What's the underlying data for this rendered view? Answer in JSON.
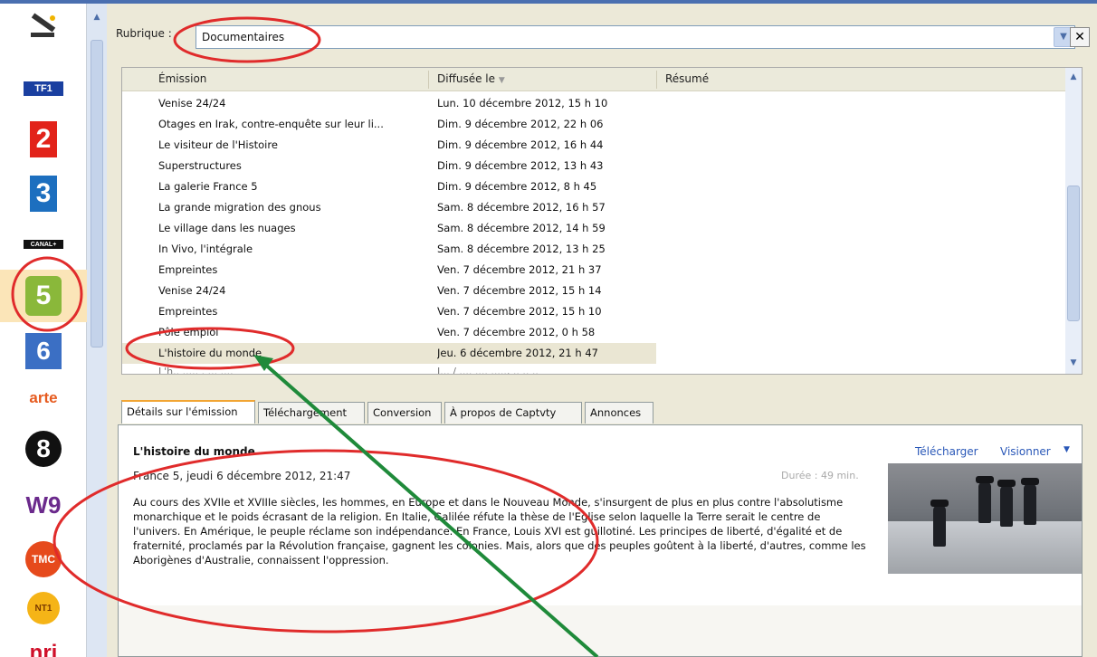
{
  "rubrique_label": "Rubrique :",
  "rubrique_value": "Documentaires",
  "columns": {
    "emission": "Émission",
    "diffusee": "Diffusée le",
    "resume": "Résumé"
  },
  "rows": [
    {
      "title": "Venise 24/24",
      "date": "Lun. 10 décembre 2012, 15 h 10"
    },
    {
      "title": "Otages en Irak, contre-enquête sur leur li...",
      "date": "Dim. 9 décembre 2012, 22 h 06"
    },
    {
      "title": "Le visiteur de l'Histoire",
      "date": "Dim. 9 décembre 2012, 16 h 44"
    },
    {
      "title": "Superstructures",
      "date": "Dim. 9 décembre 2012, 13 h 43"
    },
    {
      "title": "La galerie France 5",
      "date": "Dim. 9 décembre 2012, 8 h 45"
    },
    {
      "title": "La grande migration des gnous",
      "date": "Sam. 8 décembre 2012, 16 h 57"
    },
    {
      "title": "Le village dans les nuages",
      "date": "Sam. 8 décembre 2012, 14 h 59"
    },
    {
      "title": "In Vivo, l'intégrale",
      "date": "Sam. 8 décembre 2012, 13 h 25"
    },
    {
      "title": "Empreintes",
      "date": "Ven. 7 décembre 2012, 21 h 37"
    },
    {
      "title": "Venise 24/24",
      "date": "Ven. 7 décembre 2012, 15 h 14"
    },
    {
      "title": "Empreintes",
      "date": "Ven. 7 décembre 2012, 15 h 10"
    },
    {
      "title": "Pôle emploi",
      "date": "Ven. 7 décembre 2012, 0 h 58"
    },
    {
      "title": "L'histoire du monde",
      "date": "Jeu. 6 décembre 2012, 21 h 47"
    }
  ],
  "selected_row": 12,
  "tabs": [
    "Détails sur l'émission",
    "Téléchargement",
    "Conversion",
    "À propos de Captvty",
    "Annonces"
  ],
  "details": {
    "title": "L'histoire du monde",
    "download": "Télécharger",
    "view": "Visionner",
    "subtitle": "France 5, jeudi 6 décembre 2012, 21:47",
    "duration": "Durée : 49 min.",
    "description": "Au cours des XVIIe et XVIIIe siècles, les hommes, en Europe et dans le Nouveau Monde, s'insurgent de plus en plus contre l'absolutisme monarchique et le poids écrasant de la religion. En Italie, Galilée réfute la thèse de l'Eglise selon laquelle la Terre serait le centre de l'univers. En Amérique, le peuple réclame son indépendance. En France, Louis XVI est guillotiné. Les principes de liberté, d'égalité et de fraternité, proclamés par la Révolution française, gagnent les colonies. Mais, alors que des peuples goûtent à la liberté, d'autres, comme les Aborigènes d'Australie, connaissent l'oppression."
  },
  "channels": [
    {
      "name": "tools",
      "text": ""
    },
    {
      "name": "tf1",
      "text": "TF1"
    },
    {
      "name": "france2",
      "text": "2"
    },
    {
      "name": "france3",
      "text": "3"
    },
    {
      "name": "canalplus",
      "text": "CANAL+"
    },
    {
      "name": "france5",
      "text": "5"
    },
    {
      "name": "m6",
      "text": "6"
    },
    {
      "name": "arte",
      "text": "arte"
    },
    {
      "name": "d8",
      "text": "8"
    },
    {
      "name": "w9",
      "text": "W9"
    },
    {
      "name": "tmc",
      "text": "TMC"
    },
    {
      "name": "nt1",
      "text": "NT1"
    },
    {
      "name": "nrj12",
      "text": "nrj"
    }
  ],
  "colors": {
    "annotation_red": "#e02b2b",
    "arrow_green": "#1f8a3a",
    "selection": "#fbe5b8",
    "link_blue": "#2a58b8"
  }
}
